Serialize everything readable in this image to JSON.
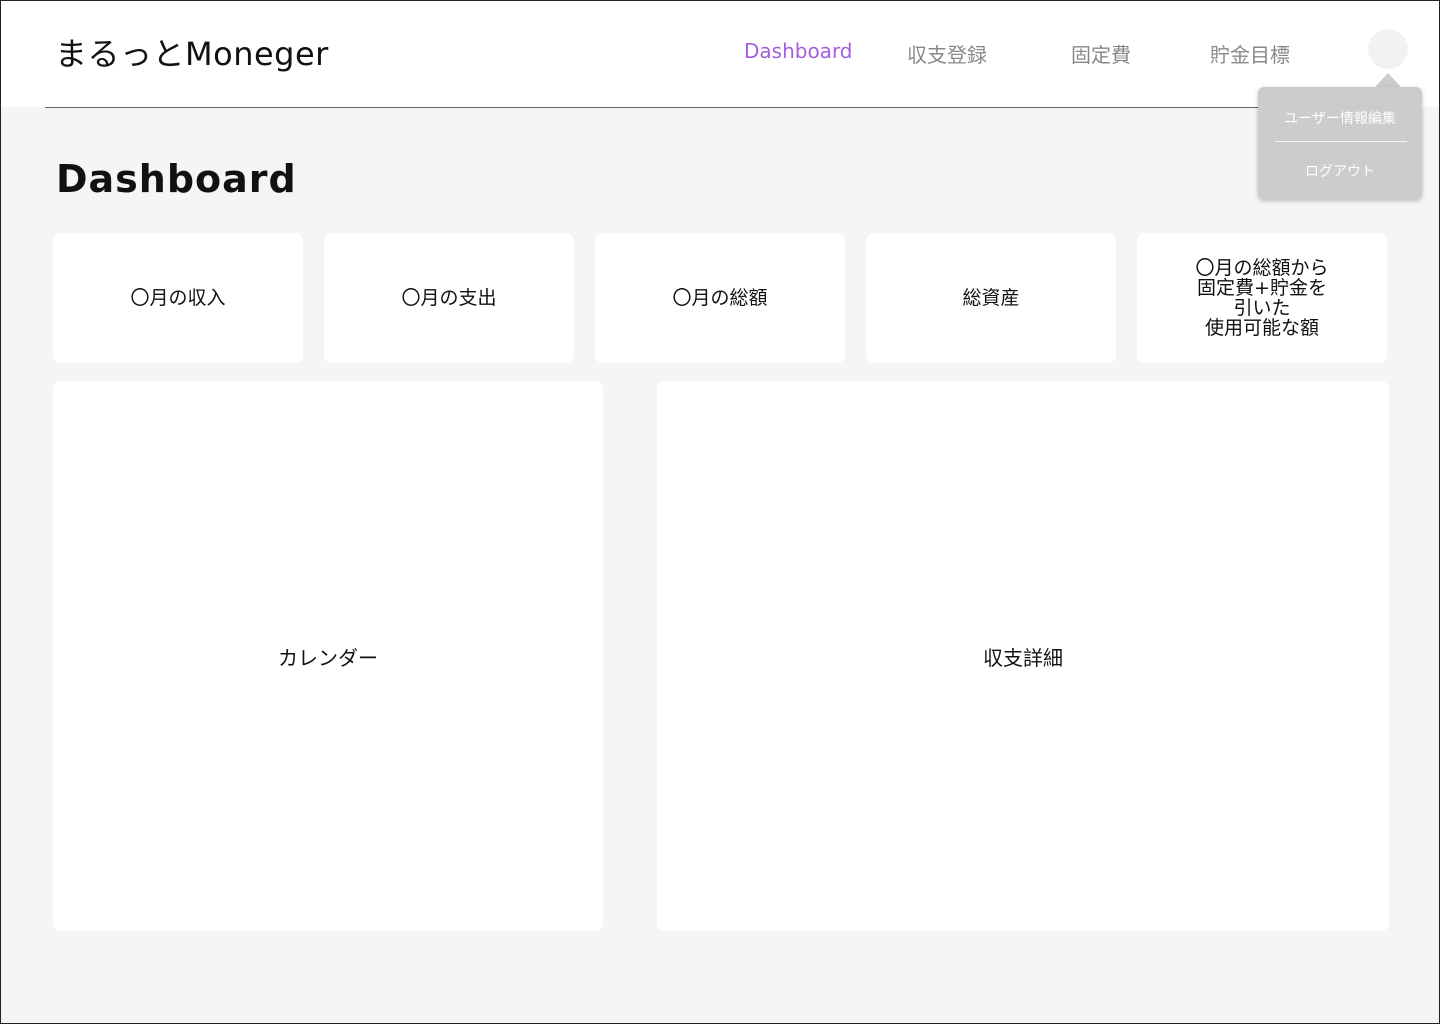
{
  "header": {
    "brand": "まるっとMoneger",
    "nav": [
      {
        "label": "Dashboard",
        "active": true
      },
      {
        "label": "収支登録",
        "active": false
      },
      {
        "label": "固定費",
        "active": false
      },
      {
        "label": "貯金目標",
        "active": false
      }
    ],
    "user_menu": {
      "items": [
        "ユーザー情報編集",
        "ログアウト"
      ]
    }
  },
  "main": {
    "title": "Dashboard",
    "cards": [
      "〇月の収入",
      "〇月の支出",
      "〇月の総額",
      "総資産",
      "〇月の総額から\n固定費+貯金を\n引いた\n使用可能な額"
    ],
    "panels": {
      "calendar": "カレンダー",
      "details": "収支詳細"
    }
  },
  "colors": {
    "accent": "#a55fdc",
    "background": "#f5f5f5",
    "dropdown": "#cccccc"
  }
}
